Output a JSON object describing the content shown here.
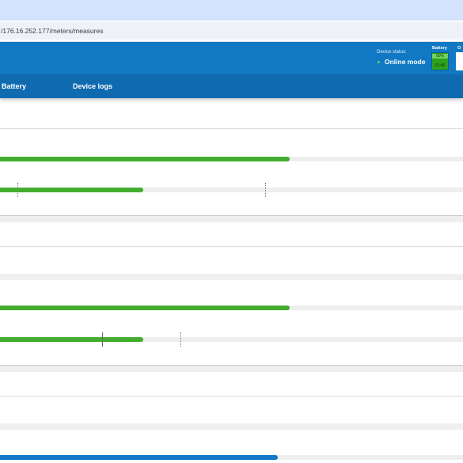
{
  "browser": {
    "url": "/176.16.252.177/meters/measures"
  },
  "header": {
    "device_status_label": "Device status:",
    "device_status_value": "Online mode",
    "status_color": "#5cd65c",
    "battery_label": "Battery",
    "battery_percent": "90%",
    "battery_time": "01:40",
    "output_label": "O",
    "brand_color": "#1179c4"
  },
  "nav": {
    "items": [
      {
        "label": "Battery"
      },
      {
        "label": "Device logs"
      }
    ]
  },
  "meters": {
    "bar_colors": {
      "primary": "#44ad2f",
      "secondary": "#1477c7"
    },
    "bars": [
      {
        "level": 0.625,
        "color": "green"
      },
      {
        "level": 0.31,
        "color": "green"
      },
      {
        "level": 0.625,
        "color": "green"
      },
      {
        "level": 0.31,
        "color": "green"
      },
      {
        "level": 0.6,
        "color": "blue"
      }
    ]
  }
}
